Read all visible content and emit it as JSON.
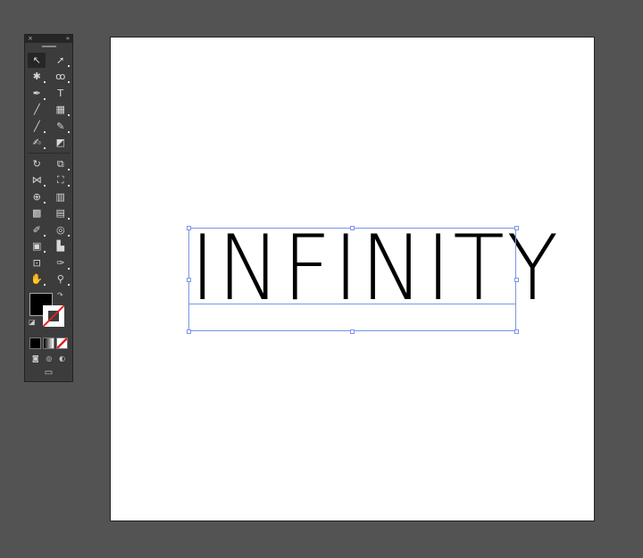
{
  "toolbar": {
    "close": "×",
    "collapse": "«",
    "tools": [
      [
        {
          "name": "selection-tool",
          "glyph": "↖"
        },
        {
          "name": "direct-selection-tool",
          "glyph": "➚"
        }
      ],
      [
        {
          "name": "magic-wand-tool",
          "glyph": "✱"
        },
        {
          "name": "lasso-tool",
          "glyph": "ꝏ"
        }
      ],
      [
        {
          "name": "pen-tool",
          "glyph": "✒"
        },
        {
          "name": "type-tool",
          "glyph": "T"
        }
      ],
      [
        {
          "name": "line-segment-tool",
          "glyph": "╱"
        },
        {
          "name": "rectangle-tool",
          "glyph": "▦"
        }
      ],
      [
        {
          "name": "paintbrush-tool",
          "glyph": "╱"
        },
        {
          "name": "pencil-tool",
          "glyph": "✎"
        }
      ],
      [
        {
          "name": "blob-brush-tool",
          "glyph": "✍"
        },
        {
          "name": "eraser-tool",
          "glyph": "◩"
        }
      ],
      [
        {
          "name": "rotate-tool",
          "glyph": "↻"
        },
        {
          "name": "scale-tool",
          "glyph": "⧉"
        }
      ],
      [
        {
          "name": "width-tool",
          "glyph": "⋈"
        },
        {
          "name": "free-transform-tool",
          "glyph": "⛶"
        }
      ],
      [
        {
          "name": "shape-builder-tool",
          "glyph": "⊕"
        },
        {
          "name": "perspective-grid-tool",
          "glyph": "▥"
        }
      ],
      [
        {
          "name": "mesh-tool",
          "glyph": "▩"
        },
        {
          "name": "gradient-tool",
          "glyph": "▤"
        }
      ],
      [
        {
          "name": "eyedropper-tool",
          "glyph": "✐"
        },
        {
          "name": "blend-tool",
          "glyph": "◎"
        }
      ],
      [
        {
          "name": "symbol-sprayer-tool",
          "glyph": "▣"
        },
        {
          "name": "column-graph-tool",
          "glyph": "▙"
        }
      ],
      [
        {
          "name": "artboard-tool",
          "glyph": "⊡"
        },
        {
          "name": "slice-tool",
          "glyph": "✑"
        }
      ],
      [
        {
          "name": "hand-tool",
          "glyph": "✋"
        },
        {
          "name": "zoom-tool",
          "glyph": "⚲"
        }
      ]
    ],
    "swap": "↷",
    "default": "◪",
    "mode": [
      "◙",
      "◎",
      "◐"
    ],
    "screen": "▭"
  },
  "artboard": {
    "text": "INFINITY"
  },
  "colors": {
    "selection": "#7b95e8",
    "fill": "#000000",
    "stroke": "#ffffff"
  }
}
